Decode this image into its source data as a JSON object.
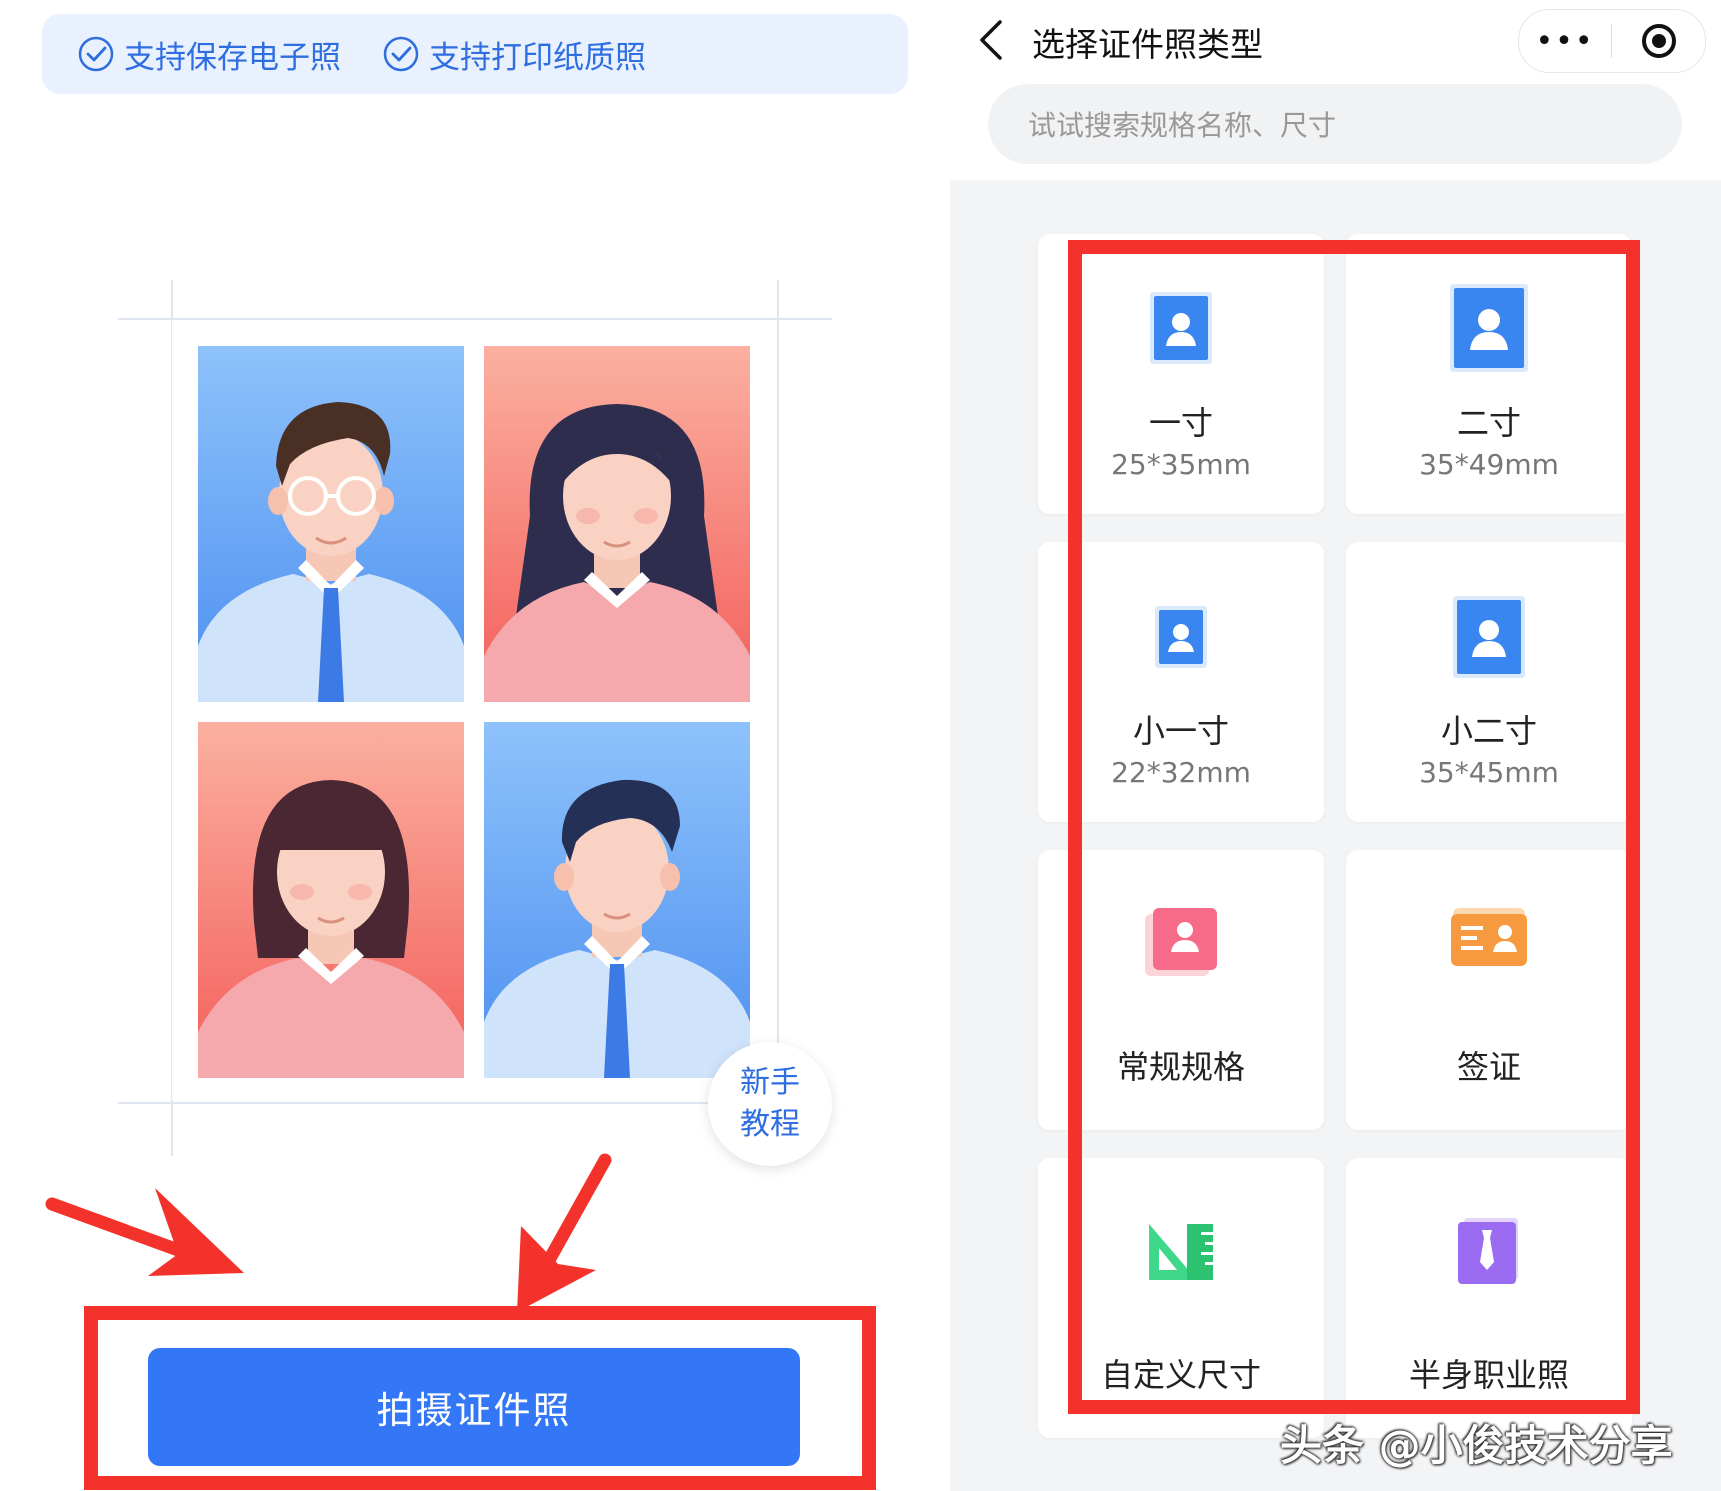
{
  "left": {
    "features": [
      {
        "icon": "check-circle-icon",
        "label": "支持保存电子照"
      },
      {
        "icon": "check-circle-icon",
        "label": "支持打印纸质照"
      }
    ],
    "tutorial_line1": "新手",
    "tutorial_line2": "教程",
    "shoot_button": "拍摄证件照"
  },
  "right": {
    "nav_title": "选择证件照类型",
    "more_label": "•••",
    "search_placeholder": "试试搜索规格名称、尺寸",
    "cards": [
      {
        "icon": "person-id-small-icon",
        "label": "一寸",
        "size": "25*35mm"
      },
      {
        "icon": "person-id-large-icon",
        "label": "二寸",
        "size": "35*49mm"
      },
      {
        "icon": "person-id-small-icon",
        "label": "小一寸",
        "size": "22*32mm"
      },
      {
        "icon": "person-id-large-icon",
        "label": "小二寸",
        "size": "35*45mm"
      },
      {
        "icon": "pink-portrait-icon",
        "label": "常规规格",
        "size": ""
      },
      {
        "icon": "visa-card-icon",
        "label": "签证",
        "size": ""
      },
      {
        "icon": "ruler-triangle-icon",
        "label": "自定义尺寸",
        "size": ""
      },
      {
        "icon": "tie-portrait-icon",
        "label": "半身职业照",
        "size": ""
      }
    ]
  },
  "watermark": "头条 @小俊技术分享",
  "colors": {
    "accent_blue": "#3477f6",
    "highlight_red": "#f2322b",
    "feature_text": "#2f6ee0"
  }
}
